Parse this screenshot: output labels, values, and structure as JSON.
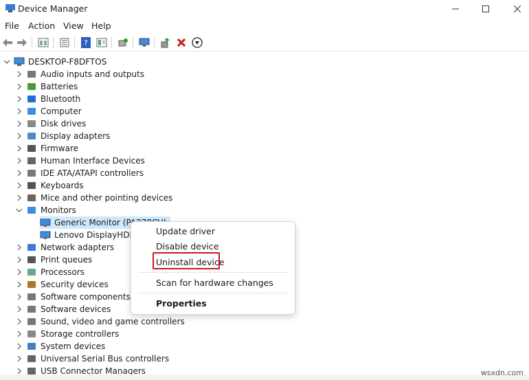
{
  "window": {
    "title": "Device Manager"
  },
  "menu": [
    "File",
    "Action",
    "View",
    "Help"
  ],
  "icons": {
    "toolbar": [
      "back-arrow-icon",
      "forward-arrow-icon",
      "show-hidden-icon",
      "properties-icon",
      "help-icon",
      "action-view-icon",
      "scan-hardware-icon",
      "monitor-icon",
      "update-driver-icon",
      "uninstall-icon",
      "download-icon"
    ]
  },
  "tree": {
    "root": "DESKTOP-F8DFTOS",
    "categories": [
      "Audio inputs and outputs",
      "Batteries",
      "Bluetooth",
      "Computer",
      "Disk drives",
      "Display adapters",
      "Firmware",
      "Human Interface Devices",
      "IDE ATA/ATAPI controllers",
      "Keyboards",
      "Mice and other pointing devices",
      "Monitors",
      "Network adapters",
      "Print queues",
      "Processors",
      "Security devices",
      "Software components",
      "Software devices",
      "Sound, video and game controllers",
      "Storage controllers",
      "System devices",
      "Universal Serial Bus controllers",
      "USB Connector Managers"
    ],
    "monitors_children": [
      "Generic Monitor (PA278CV)",
      "Lenovo DisplayHDR"
    ]
  },
  "context_menu": {
    "update": "Update driver",
    "disable": "Disable device",
    "uninstall": "Uninstall device",
    "scan": "Scan for hardware changes",
    "properties": "Properties"
  },
  "watermark": "wsxdn.com",
  "colors": {
    "selection": "#cfe8fc",
    "highlight_border": "#d1141b",
    "uninstall_x": "#d1141b"
  }
}
